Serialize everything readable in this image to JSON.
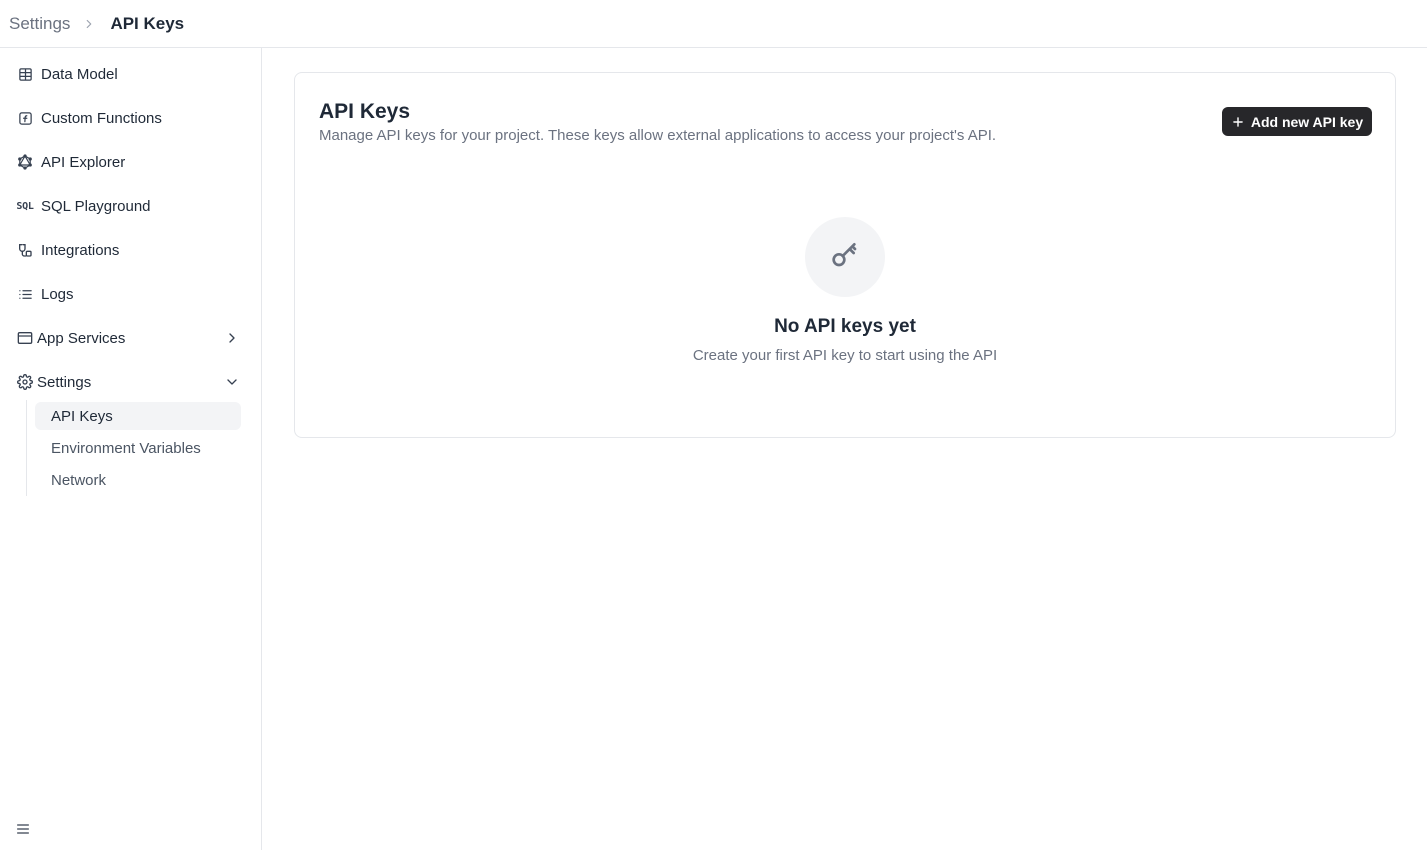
{
  "breadcrumb": {
    "root": "Settings",
    "current": "API Keys"
  },
  "sidebar": {
    "items": [
      {
        "label": "Data Model",
        "icon": "table-icon"
      },
      {
        "label": "Custom Functions",
        "icon": "function-icon"
      },
      {
        "label": "API Explorer",
        "icon": "graphql-icon"
      },
      {
        "label": "SQL Playground",
        "icon": "sql-icon",
        "icon_text": "SQL"
      },
      {
        "label": "Integrations",
        "icon": "integrations-icon"
      },
      {
        "label": "Logs",
        "icon": "list-icon"
      },
      {
        "label": "App Services",
        "icon": "app-window-icon"
      },
      {
        "label": "Settings",
        "icon": "gear-icon"
      }
    ],
    "settings_children": [
      {
        "label": "API Keys",
        "active": true
      },
      {
        "label": "Environment Variables"
      },
      {
        "label": "Network"
      }
    ]
  },
  "main": {
    "title": "API Keys",
    "description": "Manage API keys for your project. These keys allow external applications to access your project's API.",
    "add_button_label": "Add new API key",
    "empty_state": {
      "icon": "key-icon",
      "title": "No API keys yet",
      "subtitle": "Create your first API key to start using the API"
    }
  },
  "colors": {
    "primary_button_bg": "#27272a",
    "active_item_bg": "#f3f4f6",
    "border": "#e5e7eb",
    "muted_text": "#6b7280"
  }
}
